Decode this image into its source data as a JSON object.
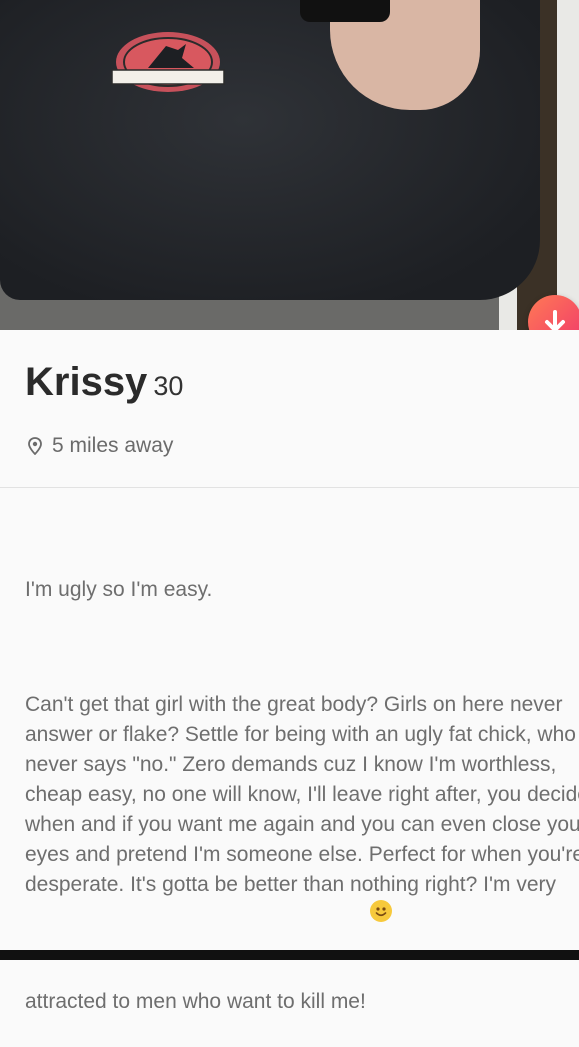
{
  "profile": {
    "name": "Krissy",
    "age": "30",
    "distance": "5 miles away",
    "photo_logo_text": "JURASSIC PARK"
  },
  "bio": {
    "headline": "I'm ugly so I'm easy.",
    "body": "Can't get that girl with the great body? Girls on here never answer or flake? Settle for being with an ugly fat chick, who never says \"no.\" Zero demands cuz I know I'm worthless, cheap easy, no one will know, I'll leave right after, you decide when and if you want me again and you can even close your eyes and pretend I'm someone else. Perfect for when you're desperate. It's gotta be better than nothing right? I'm very attracted to men who want to kill me!"
  },
  "icons": {
    "down_arrow": "arrow-down-icon",
    "location": "location-pin-icon",
    "emoji": "smiling-face-icon"
  },
  "colors": {
    "accent_start": "#ff7a55",
    "accent_end": "#f0386b"
  }
}
